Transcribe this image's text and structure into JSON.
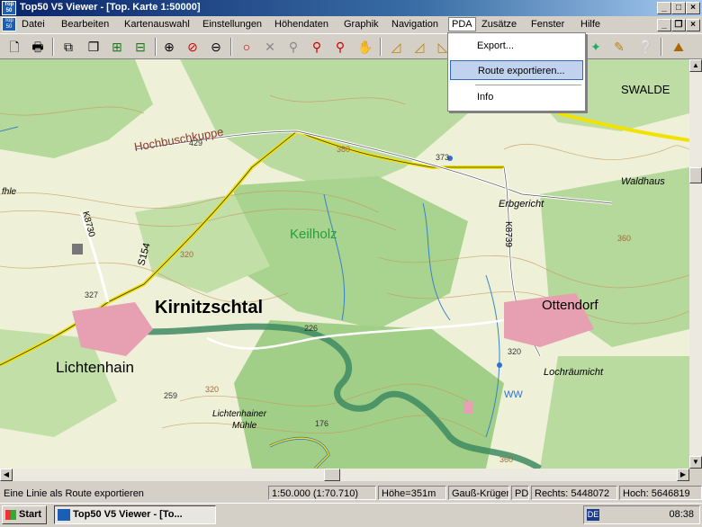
{
  "window": {
    "title": "Top50 V5 Viewer - [Top. Karte 1:50000]",
    "app_icon_text": "Top 50"
  },
  "menubar": {
    "items": [
      "Datei",
      "Bearbeiten",
      "Kartenauswahl",
      "Einstellungen",
      "Höhendaten",
      "Graphik",
      "Navigation",
      "PDA",
      "Zusätze",
      "Fenster",
      "Hilfe"
    ],
    "active": "PDA"
  },
  "pda_menu": {
    "items": [
      "Export...",
      "Route exportieren...",
      "Info"
    ],
    "highlighted": "Route exportieren..."
  },
  "toolbar": {
    "icons": [
      "new-icon",
      "print-icon",
      "copy-icon",
      "duplicate-icon",
      "zoom-in-icon",
      "zoom-out-icon",
      "zoom-fit-icon",
      "zoom-select-icon",
      "circle-icon",
      "cross-icon",
      "pin-icon",
      "pin-label-icon",
      "route-icon",
      "hand-icon",
      "measure-icon",
      "triangle-icon",
      "layers-icon",
      "help-cursor-icon",
      "3d-view-icon"
    ]
  },
  "map": {
    "labels": {
      "kirnitzschtal": "Kirnitzschtal",
      "lichtenhain": "Lichtenhain",
      "ottendorf": "Ottendorf",
      "keilholz": "Keilholz",
      "hochbuschkuppe": "Hochbuschkuppe",
      "erbgericht": "Erbgericht",
      "waldhaus": "Waldhaus",
      "swalde": "SWALDE",
      "lochraumicht": "Lochräumicht",
      "lichtenhainer": "Lichtenhainer",
      "muhle": "Mühle",
      "s154": "S154",
      "k8730": "K8730",
      "k8739": "K8739",
      "ww": "WW",
      "fhle": "fhle"
    },
    "elevations": [
      "429",
      "373",
      "320",
      "327",
      "226",
      "259",
      "176",
      "320",
      "360",
      "360",
      "380",
      "320"
    ]
  },
  "statusbar": {
    "message": "Eine Linie als Route exportieren",
    "scale": "1:50.000  (1:70.710)",
    "height": "Höhe=351m",
    "projection": "Gauß-Krüger",
    "pd": "PD",
    "rechts": "Rechts: 5448072",
    "hoch": "Hoch: 5646819"
  },
  "taskbar": {
    "start": "Start",
    "task": "Top50 V5 Viewer - [To...",
    "lang": "DE",
    "clock": "08:38"
  }
}
